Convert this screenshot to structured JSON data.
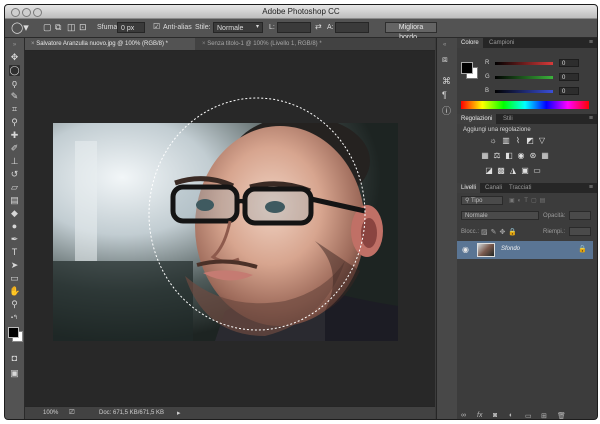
{
  "app": {
    "title": "Adobe Photoshop CC"
  },
  "options_bar": {
    "sfuma_label": "Sfuma:",
    "sfuma_value": "0 px",
    "antialias_label": "Anti-alias",
    "stile_label": "Stile:",
    "stile_value": "Normale",
    "larghezza_label": "L:",
    "altezza_label": "A:",
    "refine_button": "Migliora bordo..."
  },
  "documents": {
    "tabs": [
      {
        "label": "Salvatore Aranzulla nuovo.jpg @ 100% (RGB/8) *",
        "active": true
      },
      {
        "label": "Senza titolo-1 @ 100% (Livello 1, RGB/8) *",
        "active": false
      }
    ]
  },
  "status": {
    "zoom": "100%",
    "doc": "Doc: 671,5 KB/671,5 KB"
  },
  "color_panel": {
    "tabs": [
      "Colore",
      "Campioni"
    ],
    "channels": [
      {
        "label": "R",
        "value": "0",
        "color": "#d83a3a"
      },
      {
        "label": "G",
        "value": "0",
        "color": "#3bb33b"
      },
      {
        "label": "B",
        "value": "0",
        "color": "#3a4fd8"
      }
    ]
  },
  "adjustments_panel": {
    "tabs": [
      "Regolazioni",
      "Stili"
    ],
    "heading": "Aggiungi una regolazione"
  },
  "layers_panel": {
    "tabs": [
      "Livelli",
      "Canali",
      "Tracciati"
    ],
    "filter_label": "Tipo",
    "blend_mode": "Normale",
    "opacity_label": "Opacità:",
    "lock_label": "Blocc.:",
    "fill_label": "Riempi.:",
    "layers": [
      {
        "name": "Sfondo"
      }
    ]
  },
  "colors": {
    "panel_bg": "#3c3c3c",
    "canvas_bg": "#282828",
    "selected_layer": "#5a7594"
  }
}
